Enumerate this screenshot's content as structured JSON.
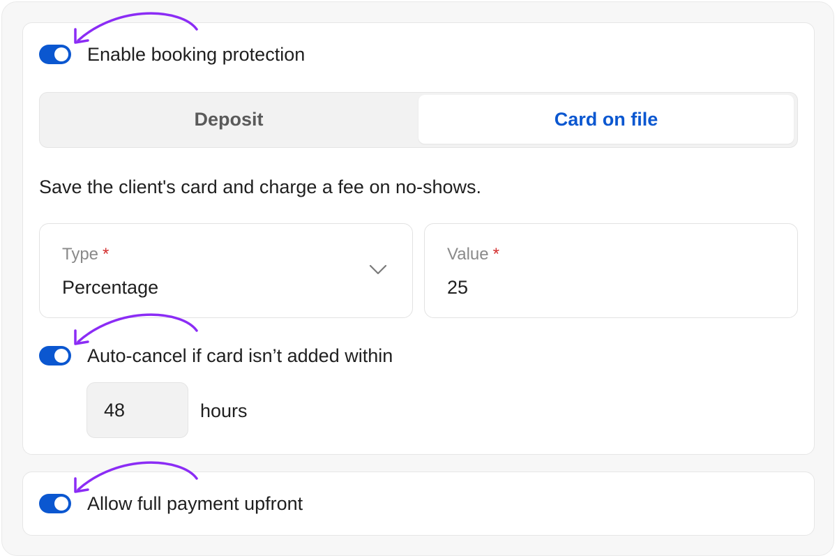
{
  "booking_protection": {
    "label": "Enable booking protection",
    "enabled": true
  },
  "tabs": [
    {
      "label": "Deposit",
      "selected": false
    },
    {
      "label": "Card on file",
      "selected": true
    }
  ],
  "description": "Save the client's card and charge a fee on no-shows.",
  "type_field": {
    "label": "Type",
    "required_mark": "*",
    "value": "Percentage"
  },
  "value_field": {
    "label": "Value",
    "required_mark": "*",
    "value": "25"
  },
  "auto_cancel": {
    "label": "Auto-cancel if card isn’t added within",
    "enabled": true,
    "hours_value": "48",
    "unit": "hours"
  },
  "full_payment": {
    "label": "Allow full payment upfront",
    "enabled": true
  },
  "colors": {
    "accent": "#0b57d0",
    "annotation_arrow": "#8b2cf5",
    "required": "#d32f2f"
  }
}
